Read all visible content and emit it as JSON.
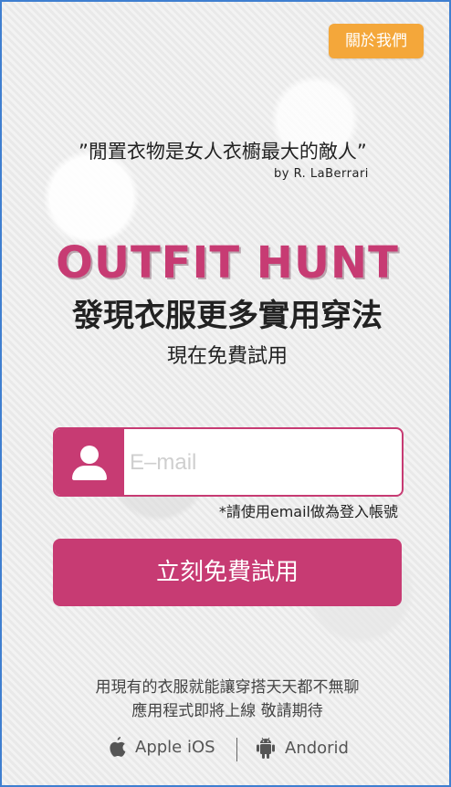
{
  "header": {
    "about_label": "關於我們"
  },
  "quote": {
    "text": "”閒置衣物是女人衣櫥最大的敵人”",
    "author": "by    R. LaBerrari"
  },
  "hero": {
    "brand": "OUTFIT HUNT",
    "headline": "發現衣服更多實用穿法",
    "subhead": "現在免費試用"
  },
  "signup": {
    "email_placeholder": "E–mail",
    "hint": "*請使用email做為登入帳號",
    "cta_label": "立刻免費試用"
  },
  "footer": {
    "tagline_line1": "用現有的衣服就能讓穿搭天天都不無聊",
    "tagline_line2": "應用程式即將上線    敬請期待",
    "ios_label": "Apple iOS",
    "android_label": "Andorid"
  },
  "colors": {
    "brand": "#c73b73",
    "accent": "#f4a73a"
  },
  "icons": {
    "user": "user-icon",
    "apple": "apple-icon",
    "android": "android-icon"
  }
}
